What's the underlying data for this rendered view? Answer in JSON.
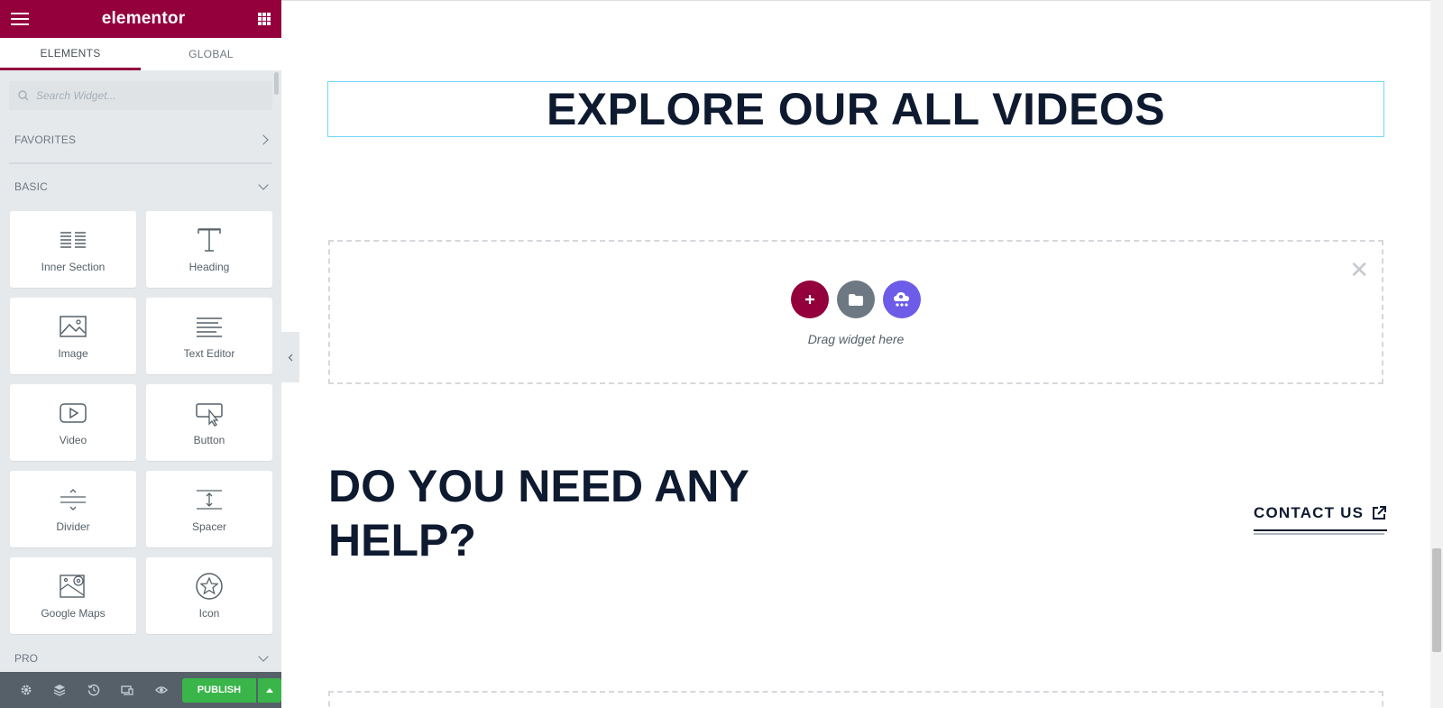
{
  "brand": {
    "name": "elementor",
    "primary_color": "#93003c",
    "publish_color": "#39b54a"
  },
  "panel": {
    "tabs": [
      {
        "label": "ELEMENTS"
      },
      {
        "label": "GLOBAL"
      }
    ],
    "search": {
      "placeholder": "Search Widget..."
    },
    "categories": {
      "favorites": "FAVORITES",
      "basic": "BASIC",
      "pro": "PRO"
    },
    "widgets": [
      {
        "label": "Inner Section",
        "icon": "inner-section-icon"
      },
      {
        "label": "Heading",
        "icon": "heading-icon"
      },
      {
        "label": "Image",
        "icon": "image-icon"
      },
      {
        "label": "Text Editor",
        "icon": "text-editor-icon"
      },
      {
        "label": "Video",
        "icon": "video-icon"
      },
      {
        "label": "Button",
        "icon": "button-icon"
      },
      {
        "label": "Divider",
        "icon": "divider-icon"
      },
      {
        "label": "Spacer",
        "icon": "spacer-icon"
      },
      {
        "label": "Google Maps",
        "icon": "google-maps-icon"
      },
      {
        "label": "Icon",
        "icon": "star-icon"
      }
    ],
    "footer": {
      "publish_label": "PUBLISH"
    }
  },
  "canvas": {
    "heading": "EXPLORE OUR ALL VIDEOS",
    "dropzone": {
      "text": "Drag widget here"
    },
    "help_title": "DO YOU NEED ANY HELP?",
    "contact_label": "CONTACT US"
  }
}
